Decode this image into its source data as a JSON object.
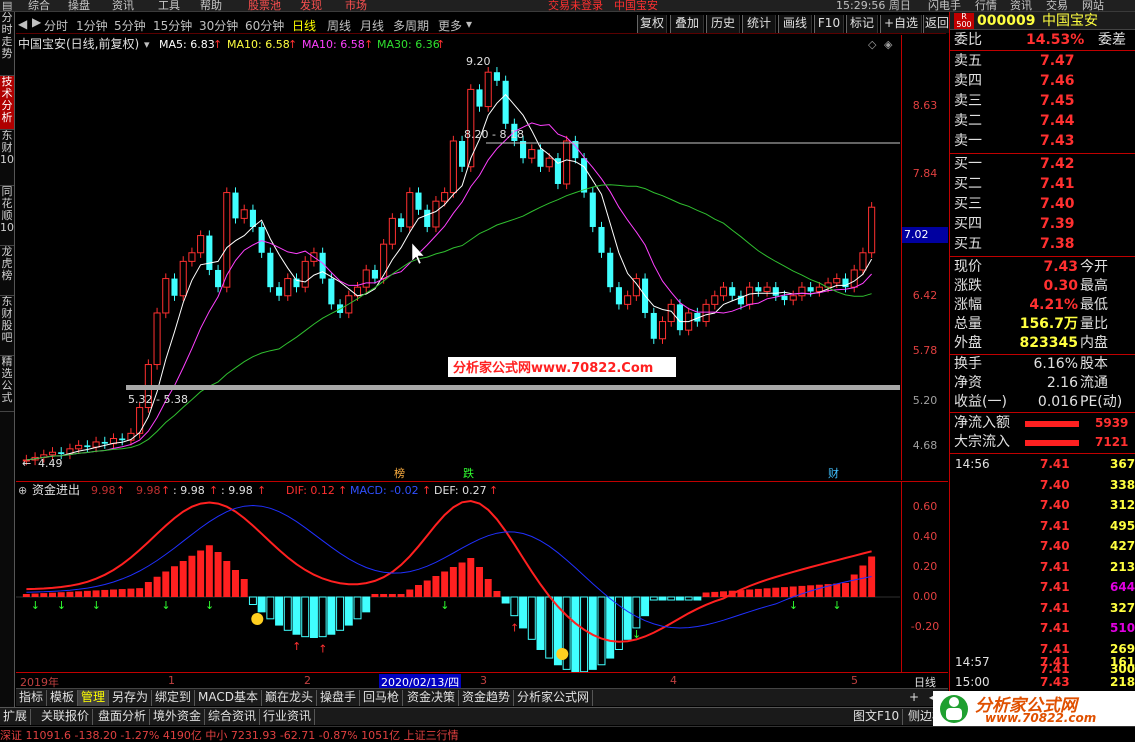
{
  "top_menu": {
    "items": [
      "综合",
      "操盘",
      "资讯",
      "工具",
      "帮助"
    ],
    "hot": [
      "股票池",
      "发现",
      "市场"
    ],
    "status": "交易未登录",
    "stock": "中国宝安",
    "time": "15:29:56 周日",
    "right_items": [
      "闪电手",
      "行情",
      "资讯",
      "交易",
      "网站"
    ]
  },
  "left_tabs": [
    "分时走势",
    "技术分析",
    "东财10",
    "同花顺10",
    "龙虎榜",
    "东财股吧",
    "精选公式"
  ],
  "period_tabs": [
    "分时",
    "1分钟",
    "5分钟",
    "15分钟",
    "30分钟",
    "60分钟",
    "日线",
    "周线",
    "月线",
    "多周期",
    "更多"
  ],
  "tool_buttons": [
    "复权",
    "叠加",
    "历史",
    "统计",
    "画线",
    "F10",
    "标记",
    "+自选",
    "返回"
  ],
  "main": {
    "title": "中国宝安(日线,前复权)",
    "ma5": "MA5: 6.83",
    "ma10a": "MA10: 6.58",
    "ma10b": "MA10: 6.58",
    "ma30": "MA30: 6.36",
    "high_label": "9.20",
    "range_label": "8.20 - 8.18",
    "range2_label": "5.32 - 5.38",
    "low_label": "4.49",
    "watermark": "分析家公式网www.70822.Com",
    "price_tag": "7.02",
    "markers": [
      "榜",
      "跌",
      "财"
    ]
  },
  "y_ticks_main": [
    "8.63",
    "7.84",
    "7.02",
    "6.42",
    "5.78",
    "5.20",
    "4.68"
  ],
  "indicator": {
    "name": "资金进出",
    "v1": "9.98",
    "v2": "9.98",
    "v3": ": 9.98",
    "v4": ": 9.98",
    "dif": "DIF: 0.12",
    "macd": "MACD: -0.02",
    "def": "DEF: 0.27"
  },
  "y_ticks_ind": [
    "0.60",
    "0.40",
    "0.20",
    "0.00",
    "-0.20"
  ],
  "date_axis": {
    "start": "2019年",
    "m1": "1",
    "m2": "2",
    "cursor": "2020/02/13/四",
    "m3": "3",
    "m4": "4",
    "m5": "5",
    "period": "日线"
  },
  "sub_tabs": [
    "指标",
    "模板",
    "管理",
    "另存为",
    "绑定到",
    "MACD基本",
    "巅在龙头",
    "操盘手",
    "回马枪",
    "资金决策",
    "资金趋势",
    "分析家公式网"
  ],
  "sub_tab_active": "管理",
  "bottom_tabs": [
    "扩展",
    "关联报价",
    "盘面分析",
    "境外资金",
    "综合资讯",
    "行业资讯"
  ],
  "bottom_right": [
    "图文F10",
    "侧边栏"
  ],
  "ticker": "深证 11091.6 -138.20 -1.27%   4190亿   中小 7231.93 -62.71 -0.87%   1051亿   上证三行情",
  "quote": {
    "badge": "R 500",
    "code": "000009",
    "name": "中国宝安",
    "weibi_label": "委比",
    "weibi": "14.53%",
    "weicha_label": "委差",
    "asks": [
      {
        "l": "卖五",
        "p": "7.47"
      },
      {
        "l": "卖四",
        "p": "7.46"
      },
      {
        "l": "卖三",
        "p": "7.45"
      },
      {
        "l": "卖二",
        "p": "7.44"
      },
      {
        "l": "卖一",
        "p": "7.43"
      }
    ],
    "bids": [
      {
        "l": "买一",
        "p": "7.42"
      },
      {
        "l": "买二",
        "p": "7.41"
      },
      {
        "l": "买三",
        "p": "7.40"
      },
      {
        "l": "买四",
        "p": "7.39"
      },
      {
        "l": "买五",
        "p": "7.38"
      }
    ],
    "stats": [
      {
        "a": "现价",
        "b": "7.43",
        "c": "今开"
      },
      {
        "a": "涨跌",
        "b": "0.30",
        "c": "最高"
      },
      {
        "a": "涨幅",
        "b": "4.21%",
        "c": "最低"
      },
      {
        "a": "总量",
        "b": "156.7万",
        "c": "量比"
      },
      {
        "a": "外盘",
        "b": "823345",
        "c": "内盘"
      }
    ],
    "stats2": [
      {
        "a": "换手",
        "b": "6.16%",
        "c": "股本"
      },
      {
        "a": "净资",
        "b": "2.16",
        "c": "流通"
      },
      {
        "a": "收益(一)",
        "b": "0.016",
        "c": "PE(动)"
      }
    ],
    "flow": [
      {
        "a": "净流入额",
        "v": "5939"
      },
      {
        "a": "大宗流入",
        "v": "7121"
      }
    ],
    "ticks": [
      {
        "t": "14:56",
        "p": "7.41",
        "v": "367"
      },
      {
        "t": "",
        "p": "7.40",
        "v": "338"
      },
      {
        "t": "",
        "p": "7.40",
        "v": "312"
      },
      {
        "t": "",
        "p": "7.41",
        "v": "495"
      },
      {
        "t": "",
        "p": "7.40",
        "v": "427"
      },
      {
        "t": "",
        "p": "7.41",
        "v": "213"
      },
      {
        "t": "",
        "p": "7.41",
        "v": "644"
      },
      {
        "t": "",
        "p": "7.41",
        "v": "327"
      },
      {
        "t": "",
        "p": "7.41",
        "v": "510"
      },
      {
        "t": "",
        "p": "7.41",
        "v": "269"
      },
      {
        "t": "",
        "p": "7.41",
        "v": "300"
      },
      {
        "t": "14:57",
        "p": "7.41",
        "v": "161"
      },
      {
        "t": "15:00",
        "p": "7.43",
        "v": "21862"
      }
    ]
  },
  "brand": {
    "name": "分析家公式网",
    "url": "www.70822.com"
  }
}
